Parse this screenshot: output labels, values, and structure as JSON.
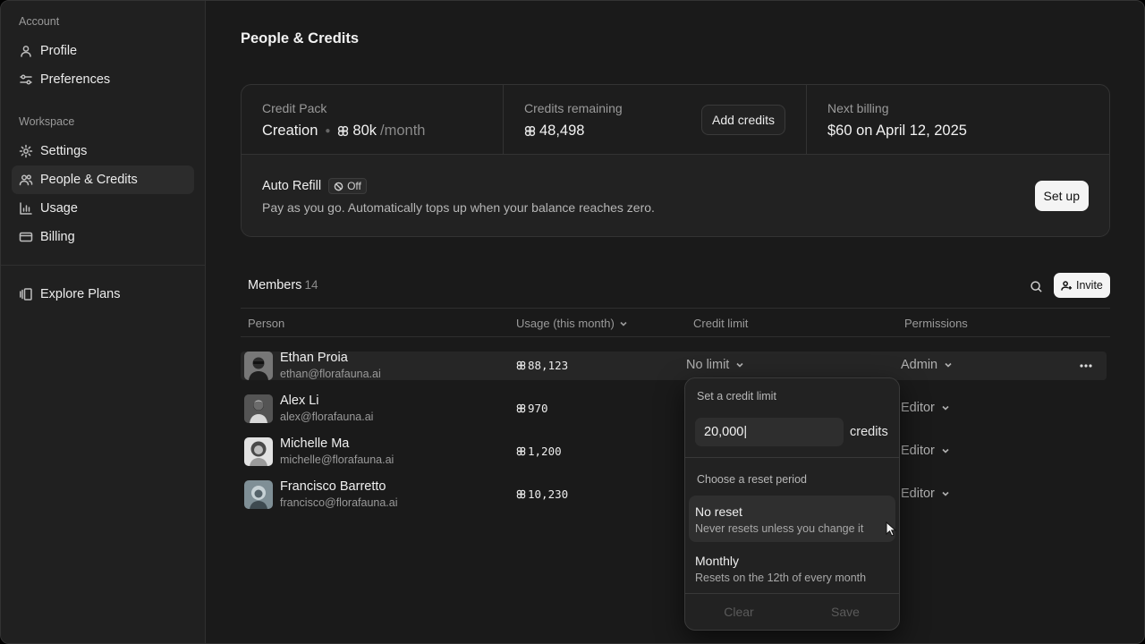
{
  "sidebar": {
    "account_label": "Account",
    "workspace_label": "Workspace",
    "items": [
      {
        "label": "Profile",
        "icon": "user-icon"
      },
      {
        "label": "Preferences",
        "icon": "sliders-icon"
      },
      {
        "label": "Settings",
        "icon": "gear-icon"
      },
      {
        "label": "People & Credits",
        "icon": "people-icon",
        "active": true
      },
      {
        "label": "Usage",
        "icon": "bar-chart-icon"
      },
      {
        "label": "Billing",
        "icon": "card-icon"
      },
      {
        "label": "Explore Plans",
        "icon": "plans-icon"
      }
    ]
  },
  "page": {
    "title": "People & Credits"
  },
  "credits_card": {
    "pack_label": "Credit Pack",
    "pack_name": "Creation",
    "pack_amount": "80k",
    "pack_period": "/month",
    "remaining_label": "Credits remaining",
    "remaining_value": "48,498",
    "add_credits_label": "Add credits",
    "next_billing_label": "Next billing",
    "next_billing_value": "$60 on April 12, 2025",
    "auto_refill_title": "Auto Refill",
    "auto_refill_status": "Off",
    "auto_refill_desc": "Pay as you go. Automatically tops up when your balance reaches zero.",
    "setup_label": "Set up"
  },
  "members": {
    "title": "Members",
    "count": "14",
    "invite_label": "Invite",
    "columns": [
      "Person",
      "Usage (this month)",
      "Credit limit",
      "Permissions"
    ],
    "rows": [
      {
        "name": "Ethan Proia",
        "email": "ethan@florafauna.ai",
        "usage": "88,123",
        "limit": "No limit",
        "permission": "Admin"
      },
      {
        "name": "Alex Li",
        "email": "alex@florafauna.ai",
        "usage": "970",
        "limit": "",
        "permission": "Editor"
      },
      {
        "name": "Michelle Ma",
        "email": "michelle@florafauna.ai",
        "usage": "1,200",
        "limit": "",
        "permission": "Editor"
      },
      {
        "name": "Francisco Barretto",
        "email": "francisco@florafauna.ai",
        "usage": "10,230",
        "limit": "",
        "permission": "Editor"
      }
    ]
  },
  "credit_limit_popover": {
    "title": "Set a credit limit",
    "input_value": "20,000|",
    "unit": "credits",
    "reset_label": "Choose a reset period",
    "options": [
      {
        "title": "No reset",
        "desc": "Never resets unless you change it",
        "selected": true
      },
      {
        "title": "Monthly",
        "desc": "Resets on the 12th of every month",
        "selected": false
      }
    ],
    "clear_label": "Clear",
    "save_label": "Save"
  }
}
